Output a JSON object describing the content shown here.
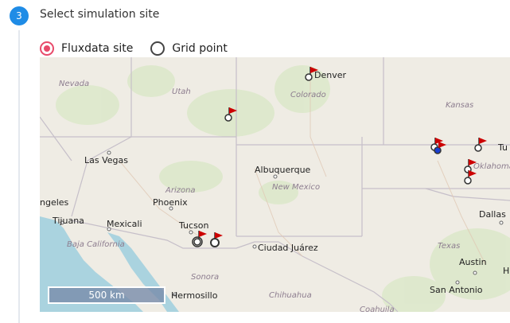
{
  "step": {
    "number": "3",
    "title": "Select simulation site"
  },
  "radios": [
    {
      "label": "Fluxdata site",
      "selected": true
    },
    {
      "label": "Grid point",
      "selected": false
    }
  ],
  "map": {
    "scale_label": "500 km",
    "colors": {
      "land": "#efece4",
      "water": "#aad3df",
      "green": "#dbe8c8",
      "border": "#c6bfc9",
      "flag": "#cc0000",
      "selected_marker": "#1a3fd1"
    },
    "states": [
      "Nevada",
      "Utah",
      "Colorado",
      "Kansas",
      "Arizona",
      "New Mexico",
      "Oklahoma",
      "Baja California",
      "Sonora",
      "Chihuahua",
      "Texas",
      "Coahuila"
    ],
    "cities": [
      "Denver",
      "Las Vegas",
      "Albuquerque",
      "ngeles",
      "Phoenix",
      "Tijuana",
      "Mexicali",
      "Tucson",
      "Ciudad Juárez",
      "Dallas",
      "Austin",
      "San Antonio",
      "Hermosillo",
      "Tu",
      "H"
    ]
  }
}
